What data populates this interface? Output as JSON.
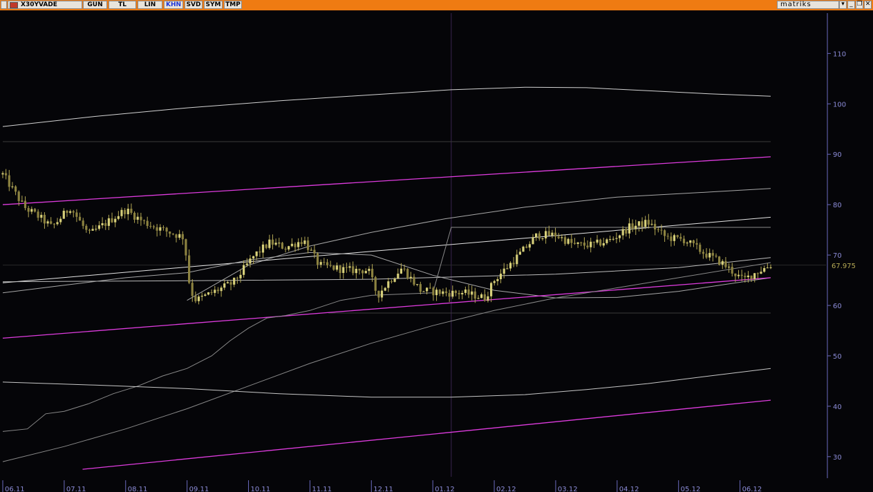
{
  "toolbar": {
    "symbol": "X30YVADE",
    "buttons": [
      "GUN",
      "TL",
      "LIN",
      "KHN",
      "SVD",
      "SYM",
      "TMP"
    ],
    "active_button": "KHN",
    "brand": "matriks",
    "window_controls": [
      "▾",
      "_",
      "❐",
      "✕"
    ],
    "accent_color": "#ef7b12"
  },
  "chart_data": {
    "type": "candlestick",
    "title": "",
    "xlabel": "",
    "ylabel": "",
    "ylim": [
      26,
      118
    ],
    "y_ticks": [
      30,
      40,
      50,
      60,
      70,
      80,
      90,
      100,
      110
    ],
    "x_tick_labels": [
      "06.11",
      "07.11",
      "08.11",
      "09.11",
      "10.11",
      "11.11",
      "12.11",
      "01.12",
      "02.12",
      "03.12",
      "04.12",
      "05.12",
      "06.12"
    ],
    "x_range": [
      0,
      13.4
    ],
    "last_price": 67.975,
    "last_price_label": "67.975",
    "price_anchors": [
      [
        0,
        86
      ],
      [
        0.35,
        79.5
      ],
      [
        0.6,
        77.5
      ],
      [
        0.8,
        75.5
      ],
      [
        1.1,
        79.5
      ],
      [
        1.4,
        74
      ],
      [
        1.7,
        76.5
      ],
      [
        2.0,
        79
      ],
      [
        2.3,
        76.5
      ],
      [
        2.6,
        75
      ],
      [
        2.95,
        73.5
      ],
      [
        3.05,
        63
      ],
      [
        3.15,
        61
      ],
      [
        3.4,
        62.5
      ],
      [
        3.75,
        64.5
      ],
      [
        4.1,
        70
      ],
      [
        4.35,
        72.5
      ],
      [
        4.6,
        71.5
      ],
      [
        4.9,
        73
      ],
      [
        5.15,
        68
      ],
      [
        5.6,
        67
      ],
      [
        5.95,
        67
      ],
      [
        6.1,
        62
      ],
      [
        6.3,
        65
      ],
      [
        6.5,
        67.5
      ],
      [
        6.8,
        63
      ],
      [
        7.2,
        62.5
      ],
      [
        7.5,
        62.5
      ],
      [
        7.85,
        61.5
      ],
      [
        8.0,
        65
      ],
      [
        8.4,
        70
      ],
      [
        8.7,
        74
      ],
      [
        9.0,
        74
      ],
      [
        9.3,
        72
      ],
      [
        9.6,
        72
      ],
      [
        9.9,
        73
      ],
      [
        10.2,
        75.5
      ],
      [
        10.5,
        76.5
      ],
      [
        10.8,
        73.5
      ],
      [
        11.1,
        73
      ],
      [
        11.4,
        70.5
      ],
      [
        11.7,
        68.5
      ],
      [
        11.9,
        66.5
      ],
      [
        12.05,
        65
      ],
      [
        12.25,
        66.5
      ],
      [
        12.5,
        68
      ]
    ],
    "candle_count": 240,
    "vertical_marker_x": 7.3,
    "grid_lines": [
      {
        "x": [
          0,
          12.5
        ],
        "y": [
          92.5,
          92.5
        ],
        "color": "#3a3a3a"
      },
      {
        "x": [
          7.3,
          12.5
        ],
        "y": [
          75.5,
          75.5
        ],
        "color": "#3a3a3a"
      },
      {
        "x": [
          5.3,
          12.5
        ],
        "y": [
          58.5,
          58.5
        ],
        "color": "#3a3a3a"
      },
      {
        "x": [
          0,
          13.4
        ],
        "y": [
          68,
          68
        ],
        "color": "#2a2a2a"
      }
    ],
    "series": [
      {
        "color": "#d4d4d4",
        "width": 1,
        "points": [
          [
            0,
            95.5
          ],
          [
            1.5,
            97.5
          ],
          [
            3,
            99.2
          ],
          [
            4.5,
            100.6
          ],
          [
            6,
            101.8
          ],
          [
            7.3,
            102.8
          ],
          [
            8.5,
            103.3
          ],
          [
            9.5,
            103.2
          ],
          [
            10.5,
            102.6
          ],
          [
            11.5,
            102
          ],
          [
            12.5,
            101.5
          ]
        ]
      },
      {
        "color": "#e03ce0",
        "width": 1.3,
        "points": [
          [
            0,
            80
          ],
          [
            12.5,
            89.5
          ]
        ]
      },
      {
        "color": "#a8a8a8",
        "width": 1,
        "points": [
          [
            3,
            61
          ],
          [
            4,
            68
          ],
          [
            5,
            71.8
          ],
          [
            6,
            74.5
          ],
          [
            7.2,
            77.2
          ],
          [
            8.5,
            79.5
          ],
          [
            10,
            81.5
          ],
          [
            11.5,
            82.5
          ],
          [
            12.5,
            83.2
          ]
        ]
      },
      {
        "color": "#e6e6e6",
        "width": 1,
        "points": [
          [
            0,
            64.5
          ],
          [
            12.5,
            77.5
          ]
        ]
      },
      {
        "color": "#bdbdbd",
        "width": 1,
        "points": [
          [
            0,
            64.7
          ],
          [
            3,
            64.9
          ],
          [
            6,
            65.2
          ],
          [
            9,
            66.2
          ],
          [
            11,
            67.5
          ],
          [
            12.5,
            69.5
          ]
        ]
      },
      {
        "color": "#a8a8a8",
        "width": 1,
        "points": [
          [
            0,
            62.5
          ],
          [
            1,
            64
          ],
          [
            2,
            65.5
          ],
          [
            3,
            66.5
          ],
          [
            4,
            69
          ],
          [
            5,
            70.5
          ],
          [
            6,
            70
          ],
          [
            7,
            66
          ],
          [
            8,
            63
          ],
          [
            9,
            61.5
          ],
          [
            10,
            61.6
          ],
          [
            11,
            62.8
          ],
          [
            12.5,
            65.5
          ]
        ]
      },
      {
        "color": "#e03ce0",
        "width": 1.3,
        "points": [
          [
            0,
            53.5
          ],
          [
            12.5,
            65.5
          ]
        ]
      },
      {
        "color": "#8a8a8a",
        "width": 1,
        "points": [
          [
            0,
            29
          ],
          [
            1,
            32
          ],
          [
            2,
            35.5
          ],
          [
            3,
            39.5
          ],
          [
            4,
            44
          ],
          [
            5,
            48.5
          ],
          [
            6,
            52.5
          ],
          [
            7,
            56
          ],
          [
            8,
            59
          ],
          [
            9,
            61.5
          ],
          [
            10,
            63.5
          ],
          [
            11,
            65.5
          ],
          [
            12.5,
            68.5
          ]
        ]
      },
      {
        "color": "#8a8a8a",
        "width": 1,
        "points": [
          [
            0,
            35
          ],
          [
            0.4,
            35.5
          ],
          [
            0.7,
            38.5
          ],
          [
            1.0,
            39
          ],
          [
            1.4,
            40.5
          ],
          [
            1.8,
            42.5
          ],
          [
            2.2,
            44
          ],
          [
            2.6,
            46
          ],
          [
            3.0,
            47.5
          ],
          [
            3.4,
            50
          ],
          [
            3.7,
            53
          ],
          [
            4.0,
            55.5
          ],
          [
            4.3,
            57.5
          ],
          [
            4.6,
            58
          ],
          [
            5.0,
            59
          ],
          [
            5.5,
            61
          ],
          [
            6.0,
            62
          ],
          [
            7.0,
            62.5
          ],
          [
            7.3,
            75.5
          ],
          [
            12.5,
            75.5
          ]
        ]
      },
      {
        "color": "#c8c8c8",
        "width": 1,
        "points": [
          [
            0,
            44.8
          ],
          [
            1.5,
            44.2
          ],
          [
            3,
            43.5
          ],
          [
            4.5,
            42.5
          ],
          [
            6,
            41.8
          ],
          [
            7.3,
            41.8
          ],
          [
            8.5,
            42.3
          ],
          [
            9.5,
            43.3
          ],
          [
            10.5,
            44.5
          ],
          [
            11.5,
            46
          ],
          [
            12.5,
            47.5
          ]
        ]
      },
      {
        "color": "#e03ce0",
        "width": 1.3,
        "points": [
          [
            1.3,
            27.5
          ],
          [
            12.5,
            41.2
          ]
        ]
      }
    ]
  }
}
